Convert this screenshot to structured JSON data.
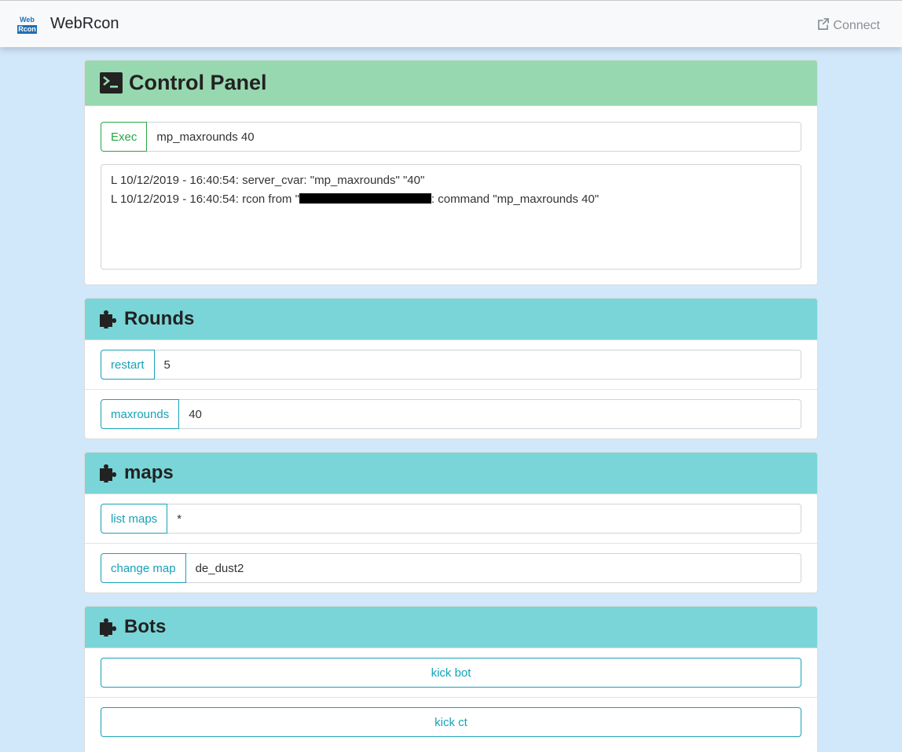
{
  "navbar": {
    "logo_top": "Web",
    "logo_bottom": "Rcon",
    "brand": "WebRcon",
    "connect_label": "Connect",
    "connect_icon": "external-link-icon"
  },
  "control_panel": {
    "title": "Control Panel",
    "icon": "terminal-icon",
    "exec_label": "Exec",
    "command_value": "mp_maxrounds 40",
    "log": [
      "L 10/12/2019 - 16:40:54: server_cvar: \"mp_maxrounds\" \"40\"",
      {
        "prefix": "L 10/12/2019 - 16:40:54: rcon from \"",
        "suffix": ": command \"mp_maxrounds 40\""
      }
    ]
  },
  "rounds": {
    "title": "Rounds",
    "icon": "puzzle-icon",
    "restart_label": "restart",
    "restart_value": "5",
    "maxrounds_label": "maxrounds",
    "maxrounds_value": "40"
  },
  "maps": {
    "title": "maps",
    "icon": "puzzle-icon",
    "list_label": "list maps",
    "list_value": "*",
    "change_label": "change map",
    "change_value": "de_dust2"
  },
  "bots": {
    "title": "Bots",
    "icon": "puzzle-icon",
    "kick_bot_label": "kick bot",
    "kick_ct_label": "kick ct"
  },
  "colors": {
    "page_bg": "#d1e7fa",
    "control_header": "#98d8b0",
    "plugin_header": "#79d5d7",
    "info": "#17a2b8",
    "success": "#28a745"
  }
}
